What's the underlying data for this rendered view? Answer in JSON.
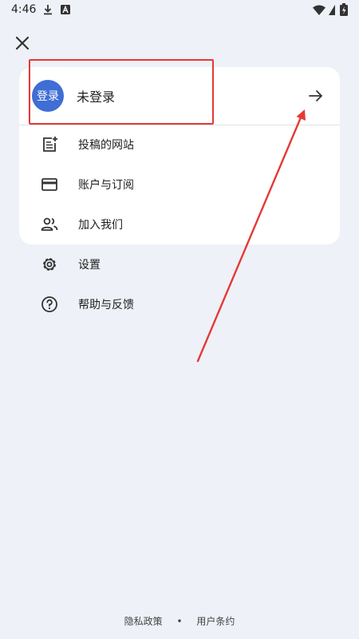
{
  "status_bar": {
    "time": "4:46"
  },
  "account": {
    "avatar_text": "登录",
    "label": "未登录"
  },
  "menu": {
    "card_items": [
      {
        "label": "投稿的网站",
        "icon": "post-add-icon"
      },
      {
        "label": "账户与订阅",
        "icon": "credit-card-icon"
      },
      {
        "label": "加入我们",
        "icon": "people-icon"
      }
    ],
    "other_items": [
      {
        "label": "设置",
        "icon": "gear-icon"
      },
      {
        "label": "帮助与反馈",
        "icon": "help-circle-icon"
      }
    ]
  },
  "footer": {
    "privacy": "隐私政策",
    "separator": "•",
    "terms": "用户条约"
  },
  "colors": {
    "background": "#eef1f7",
    "card": "#ffffff",
    "avatar": "#3f6ed4",
    "annotation": "#e53935"
  }
}
